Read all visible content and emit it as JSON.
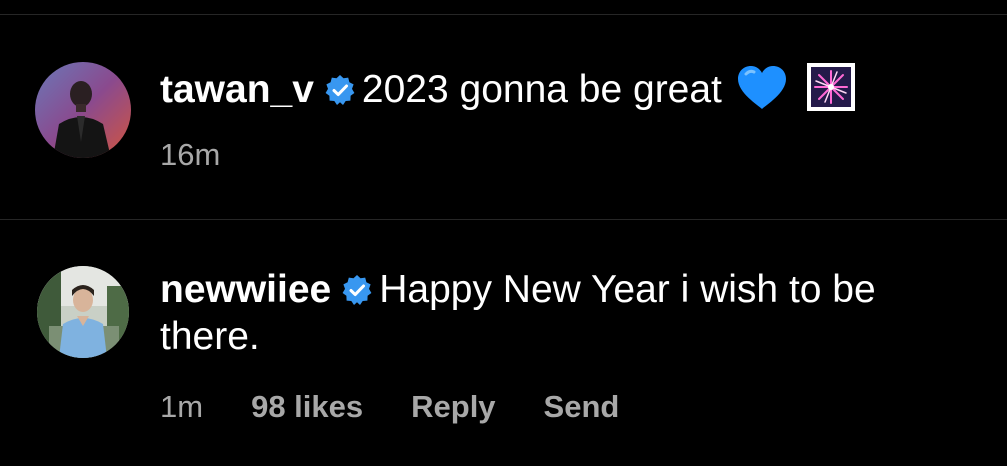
{
  "comments": [
    {
      "username": "tawan_v",
      "text": "2023 gonna be great",
      "emoji": [
        "blue-heart-icon",
        "fireworks-icon"
      ],
      "timestamp": "16m"
    },
    {
      "username": "newwiiee",
      "text_line1": "Happy New Year i wish to be",
      "text_line2": "there.",
      "timestamp": "1m",
      "likes": "98 likes",
      "reply_label": "Reply",
      "send_label": "Send"
    }
  ],
  "colors": {
    "background": "#000000",
    "text": "#ffffff",
    "secondary_text": "#a8a8a8",
    "verified_badge": "#3897f0",
    "divider": "#262626",
    "heart": "#1e90ff"
  }
}
